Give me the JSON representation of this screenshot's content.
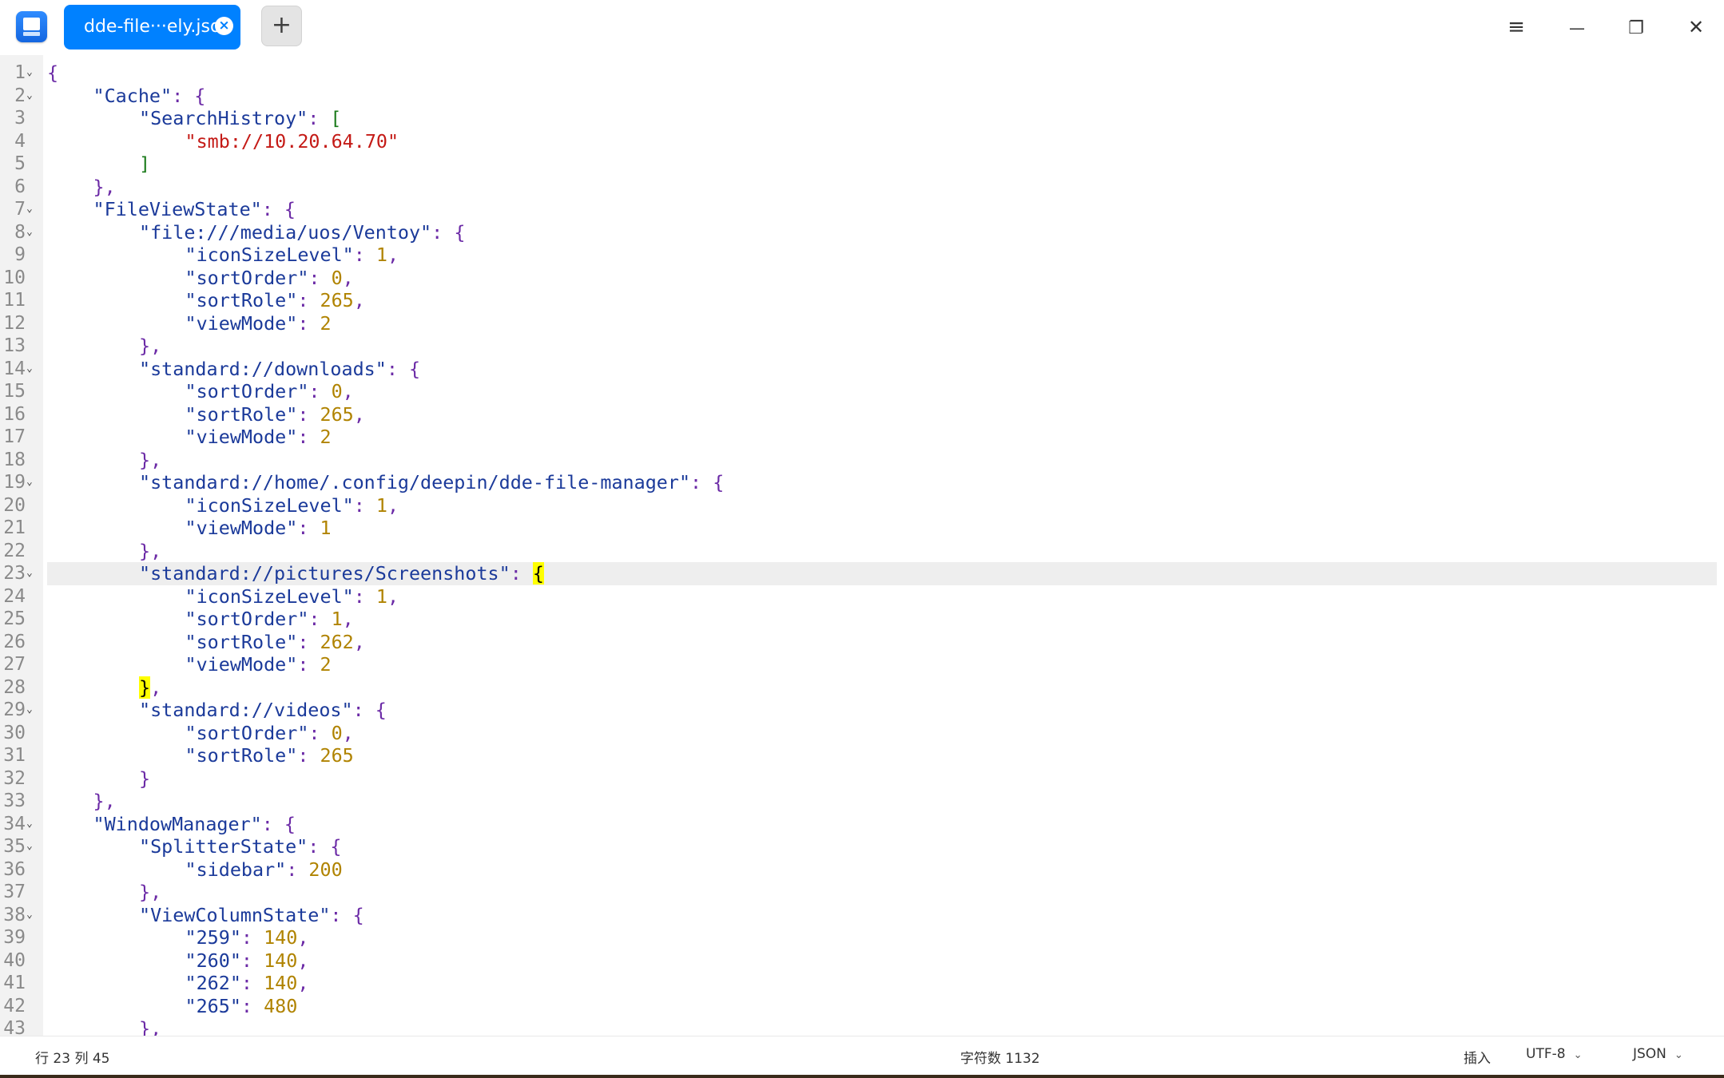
{
  "titlebar": {
    "tab_label": "dde-file···ely.jso",
    "tab_close_glyph": "×",
    "new_tab_glyph": "+",
    "menu_glyph": "≡",
    "minimize_glyph": "—",
    "maximize_glyph": "❐",
    "close_glyph": "✕"
  },
  "editor": {
    "current_line": 23,
    "lines": [
      {
        "n": "1",
        "fold": true,
        "indent": 0,
        "parts": [
          [
            "p",
            "{"
          ]
        ]
      },
      {
        "n": "2",
        "fold": true,
        "indent": 1,
        "parts": [
          [
            "k",
            "\"Cache\""
          ],
          [
            "p",
            ": {"
          ]
        ]
      },
      {
        "n": "3",
        "fold": false,
        "indent": 2,
        "parts": [
          [
            "k",
            "\"SearchHistroy\""
          ],
          [
            "p",
            ": "
          ],
          [
            "b",
            "["
          ]
        ]
      },
      {
        "n": "4",
        "fold": false,
        "indent": 3,
        "parts": [
          [
            "s",
            "\"smb://10.20.64.70\""
          ]
        ]
      },
      {
        "n": "5",
        "fold": false,
        "indent": 2,
        "parts": [
          [
            "b",
            "]"
          ]
        ]
      },
      {
        "n": "6",
        "fold": false,
        "indent": 1,
        "parts": [
          [
            "p",
            "},"
          ]
        ]
      },
      {
        "n": "7",
        "fold": true,
        "indent": 1,
        "parts": [
          [
            "k",
            "\"FileViewState\""
          ],
          [
            "p",
            ": {"
          ]
        ]
      },
      {
        "n": "8",
        "fold": true,
        "indent": 2,
        "parts": [
          [
            "k",
            "\"file:///media/uos/Ventoy\""
          ],
          [
            "p",
            ": {"
          ]
        ]
      },
      {
        "n": "9",
        "fold": false,
        "indent": 3,
        "parts": [
          [
            "k",
            "\"iconSizeLevel\""
          ],
          [
            "p",
            ": "
          ],
          [
            "n",
            "1"
          ],
          [
            "p",
            ","
          ]
        ]
      },
      {
        "n": "10",
        "fold": false,
        "indent": 3,
        "parts": [
          [
            "k",
            "\"sortOrder\""
          ],
          [
            "p",
            ": "
          ],
          [
            "n",
            "0"
          ],
          [
            "p",
            ","
          ]
        ]
      },
      {
        "n": "11",
        "fold": false,
        "indent": 3,
        "parts": [
          [
            "k",
            "\"sortRole\""
          ],
          [
            "p",
            ": "
          ],
          [
            "n",
            "265"
          ],
          [
            "p",
            ","
          ]
        ]
      },
      {
        "n": "12",
        "fold": false,
        "indent": 3,
        "parts": [
          [
            "k",
            "\"viewMode\""
          ],
          [
            "p",
            ": "
          ],
          [
            "n",
            "2"
          ]
        ]
      },
      {
        "n": "13",
        "fold": false,
        "indent": 2,
        "parts": [
          [
            "p",
            "},"
          ]
        ]
      },
      {
        "n": "14",
        "fold": true,
        "indent": 2,
        "parts": [
          [
            "k",
            "\"standard://downloads\""
          ],
          [
            "p",
            ": {"
          ]
        ]
      },
      {
        "n": "15",
        "fold": false,
        "indent": 3,
        "parts": [
          [
            "k",
            "\"sortOrder\""
          ],
          [
            "p",
            ": "
          ],
          [
            "n",
            "0"
          ],
          [
            "p",
            ","
          ]
        ]
      },
      {
        "n": "16",
        "fold": false,
        "indent": 3,
        "parts": [
          [
            "k",
            "\"sortRole\""
          ],
          [
            "p",
            ": "
          ],
          [
            "n",
            "265"
          ],
          [
            "p",
            ","
          ]
        ]
      },
      {
        "n": "17",
        "fold": false,
        "indent": 3,
        "parts": [
          [
            "k",
            "\"viewMode\""
          ],
          [
            "p",
            ": "
          ],
          [
            "n",
            "2"
          ]
        ]
      },
      {
        "n": "18",
        "fold": false,
        "indent": 2,
        "parts": [
          [
            "p",
            "},"
          ]
        ]
      },
      {
        "n": "19",
        "fold": true,
        "indent": 2,
        "parts": [
          [
            "k",
            "\"standard://home/.config/deepin/dde-file-manager\""
          ],
          [
            "p",
            ": {"
          ]
        ]
      },
      {
        "n": "20",
        "fold": false,
        "indent": 3,
        "parts": [
          [
            "k",
            "\"iconSizeLevel\""
          ],
          [
            "p",
            ": "
          ],
          [
            "n",
            "1"
          ],
          [
            "p",
            ","
          ]
        ]
      },
      {
        "n": "21",
        "fold": false,
        "indent": 3,
        "parts": [
          [
            "k",
            "\"viewMode\""
          ],
          [
            "p",
            ": "
          ],
          [
            "n",
            "1"
          ]
        ]
      },
      {
        "n": "22",
        "fold": false,
        "indent": 2,
        "parts": [
          [
            "p",
            "},"
          ]
        ]
      },
      {
        "n": "23",
        "fold": true,
        "indent": 2,
        "parts": [
          [
            "k",
            "\"standard://pictures/Screenshots\""
          ],
          [
            "p",
            ": "
          ],
          [
            "hl",
            "{"
          ]
        ]
      },
      {
        "n": "24",
        "fold": false,
        "indent": 3,
        "parts": [
          [
            "k",
            "\"iconSizeLevel\""
          ],
          [
            "p",
            ": "
          ],
          [
            "n",
            "1"
          ],
          [
            "p",
            ","
          ]
        ]
      },
      {
        "n": "25",
        "fold": false,
        "indent": 3,
        "parts": [
          [
            "k",
            "\"sortOrder\""
          ],
          [
            "p",
            ": "
          ],
          [
            "n",
            "1"
          ],
          [
            "p",
            ","
          ]
        ]
      },
      {
        "n": "26",
        "fold": false,
        "indent": 3,
        "parts": [
          [
            "k",
            "\"sortRole\""
          ],
          [
            "p",
            ": "
          ],
          [
            "n",
            "262"
          ],
          [
            "p",
            ","
          ]
        ]
      },
      {
        "n": "27",
        "fold": false,
        "indent": 3,
        "parts": [
          [
            "k",
            "\"viewMode\""
          ],
          [
            "p",
            ": "
          ],
          [
            "n",
            "2"
          ]
        ]
      },
      {
        "n": "28",
        "fold": false,
        "indent": 2,
        "parts": [
          [
            "hl",
            "}"
          ],
          [
            "p",
            ","
          ]
        ]
      },
      {
        "n": "29",
        "fold": true,
        "indent": 2,
        "parts": [
          [
            "k",
            "\"standard://videos\""
          ],
          [
            "p",
            ": {"
          ]
        ]
      },
      {
        "n": "30",
        "fold": false,
        "indent": 3,
        "parts": [
          [
            "k",
            "\"sortOrder\""
          ],
          [
            "p",
            ": "
          ],
          [
            "n",
            "0"
          ],
          [
            "p",
            ","
          ]
        ]
      },
      {
        "n": "31",
        "fold": false,
        "indent": 3,
        "parts": [
          [
            "k",
            "\"sortRole\""
          ],
          [
            "p",
            ": "
          ],
          [
            "n",
            "265"
          ]
        ]
      },
      {
        "n": "32",
        "fold": false,
        "indent": 2,
        "parts": [
          [
            "p",
            "}"
          ]
        ]
      },
      {
        "n": "33",
        "fold": false,
        "indent": 1,
        "parts": [
          [
            "p",
            "},"
          ]
        ]
      },
      {
        "n": "34",
        "fold": true,
        "indent": 1,
        "parts": [
          [
            "k",
            "\"WindowManager\""
          ],
          [
            "p",
            ": {"
          ]
        ]
      },
      {
        "n": "35",
        "fold": true,
        "indent": 2,
        "parts": [
          [
            "k",
            "\"SplitterState\""
          ],
          [
            "p",
            ": {"
          ]
        ]
      },
      {
        "n": "36",
        "fold": false,
        "indent": 3,
        "parts": [
          [
            "k",
            "\"sidebar\""
          ],
          [
            "p",
            ": "
          ],
          [
            "n",
            "200"
          ]
        ]
      },
      {
        "n": "37",
        "fold": false,
        "indent": 2,
        "parts": [
          [
            "p",
            "},"
          ]
        ]
      },
      {
        "n": "38",
        "fold": true,
        "indent": 2,
        "parts": [
          [
            "k",
            "\"ViewColumnState\""
          ],
          [
            "p",
            ": {"
          ]
        ]
      },
      {
        "n": "39",
        "fold": false,
        "indent": 3,
        "parts": [
          [
            "k",
            "\"259\""
          ],
          [
            "p",
            ": "
          ],
          [
            "n",
            "140"
          ],
          [
            "p",
            ","
          ]
        ]
      },
      {
        "n": "40",
        "fold": false,
        "indent": 3,
        "parts": [
          [
            "k",
            "\"260\""
          ],
          [
            "p",
            ": "
          ],
          [
            "n",
            "140"
          ],
          [
            "p",
            ","
          ]
        ]
      },
      {
        "n": "41",
        "fold": false,
        "indent": 3,
        "parts": [
          [
            "k",
            "\"262\""
          ],
          [
            "p",
            ": "
          ],
          [
            "n",
            "140"
          ],
          [
            "p",
            ","
          ]
        ]
      },
      {
        "n": "42",
        "fold": false,
        "indent": 3,
        "parts": [
          [
            "k",
            "\"265\""
          ],
          [
            "p",
            ": "
          ],
          [
            "n",
            "480"
          ]
        ]
      },
      {
        "n": "43",
        "fold": false,
        "indent": 2,
        "parts": [
          [
            "p",
            "},"
          ]
        ]
      }
    ]
  },
  "statusbar": {
    "position": "行 23  列 45",
    "char_count": "字符数 1132",
    "insert_mode": "插入",
    "encoding": "UTF-8",
    "language": "JSON",
    "chevron": "⌄"
  },
  "colors": {
    "accent": "#0081ff",
    "key": "#1b3a9a",
    "string": "#c41a16",
    "number": "#b08300",
    "punct": "#6b2aa6",
    "highlight": "#ffff00"
  }
}
